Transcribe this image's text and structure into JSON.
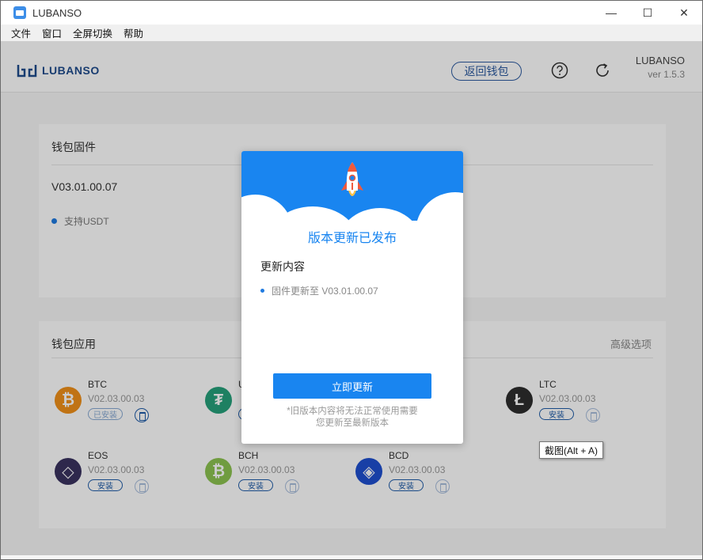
{
  "window": {
    "title": "LUBANSO",
    "minimize": "—",
    "maximize": "☐",
    "close": "✕"
  },
  "menu": [
    "文件",
    "窗口",
    "全屏切换",
    "帮助"
  ],
  "header": {
    "logo_text": "LUBANSO",
    "back_label": "返回钱包",
    "help_icon": "help-circle-icon",
    "refresh_icon": "refresh-icon",
    "brand": "LUBANSO",
    "version": "ver 1.5.3"
  },
  "firmware": {
    "title": "钱包固件",
    "version": "V03.01.00.07",
    "features": [
      "支持USDT"
    ]
  },
  "apps": {
    "title": "钱包应用",
    "advanced": "高级选项",
    "items": [
      {
        "name": "BTC",
        "version": "V02.03.00.03",
        "status": "已安装",
        "installed": true,
        "color": "#f0901a",
        "glyph": "₿"
      },
      {
        "name": "U",
        "version": "",
        "status": "",
        "installed": false,
        "color": "#26a17b",
        "glyph": "₮"
      },
      {
        "name": "LTC",
        "version": "V02.03.00.03",
        "status": "安装",
        "installed": false,
        "color": "#2e2e2e",
        "glyph": "Ł"
      },
      {
        "name": "EOS",
        "version": "V02.03.00.03",
        "status": "安装",
        "installed": false,
        "color": "#3a3260",
        "glyph": "◇"
      },
      {
        "name": "BCH",
        "version": "V02.03.00.03",
        "status": "安装",
        "installed": false,
        "color": "#8dc351",
        "glyph": "₿"
      },
      {
        "name": "BCD",
        "version": "V02.03.00.03",
        "status": "安装",
        "installed": false,
        "color": "#1e4fd0",
        "glyph": "◈"
      }
    ]
  },
  "modal": {
    "title": "版本更新已发布",
    "section": "更新内容",
    "items": [
      "固件更新至 V03.01.00.07"
    ],
    "button": "立即更新",
    "note_line1": "*旧版本内容将无法正常使用需要",
    "note_line2": "您更新至最新版本"
  },
  "tooltip": "截图(Alt + A)",
  "colors": {
    "accent": "#1985f0",
    "brand": "#1f4c8c"
  }
}
